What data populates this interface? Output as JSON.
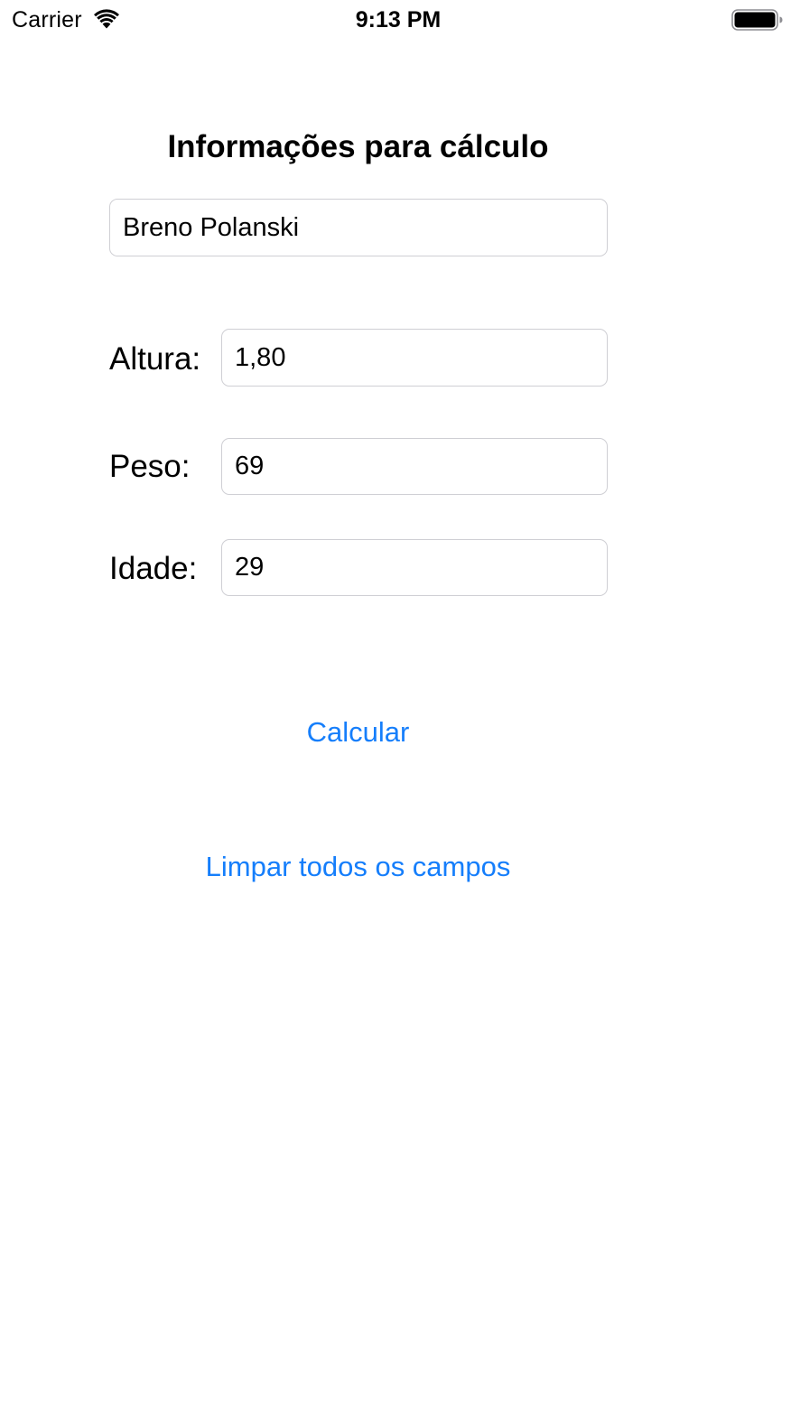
{
  "status_bar": {
    "carrier": "Carrier",
    "time": "9:13 PM",
    "wifi_icon": "wifi-icon",
    "battery_icon": "battery-icon",
    "battery_level": 1.0
  },
  "form": {
    "title": "Informações para cálculo",
    "name_value": "Breno Polanski",
    "height_label": "Altura:",
    "height_value": "1,80",
    "weight_label": "Peso:",
    "weight_value": "69",
    "age_label": "Idade:",
    "age_value": "29"
  },
  "actions": {
    "calculate_label": "Calcular",
    "clear_label": "Limpar todos os campos"
  },
  "colors": {
    "accent": "#157efb",
    "field_border": "#cfcfd4",
    "text": "#000000",
    "background": "#ffffff"
  }
}
